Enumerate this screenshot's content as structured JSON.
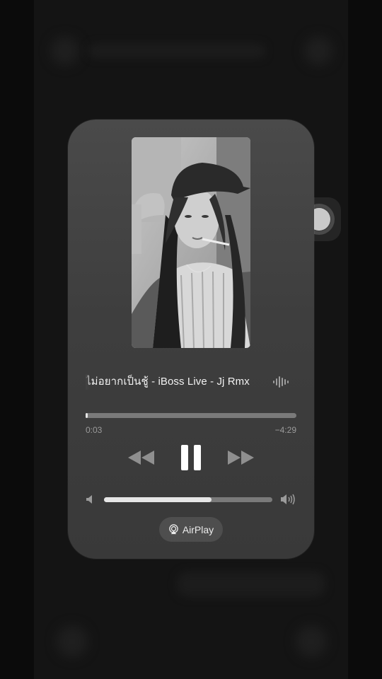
{
  "now_playing": {
    "title": "ไม่อยากเป็นชู้ - iBoss Live - Jj Rmx",
    "elapsed": "0:03",
    "remaining": "−4:29",
    "progress_fraction": 0.011
  },
  "volume": {
    "level_fraction": 0.64
  },
  "airplay": {
    "label": "AirPlay"
  },
  "icons": {
    "rewind": "rewind-icon",
    "pause": "pause-icon",
    "fast_forward": "fast-forward-icon",
    "volume_low": "speaker-low-icon",
    "volume_high": "speaker-high-icon",
    "airplay": "airplay-icon",
    "audio_wave": "audio-wave-icon",
    "assistive_touch": "assistive-touch-icon"
  },
  "colors": {
    "card": "#414141",
    "track": "#7a7a7a",
    "fill": "#e6e6e6",
    "text": "#f2f2f2",
    "muted": "#9b9b9b"
  }
}
